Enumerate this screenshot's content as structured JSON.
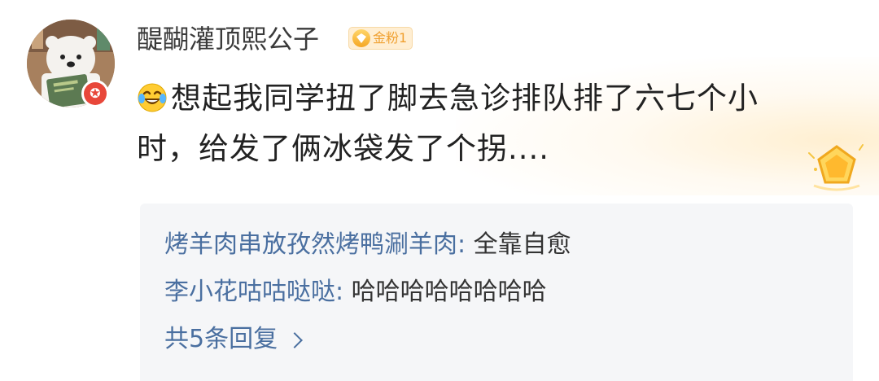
{
  "user": {
    "name": "醍醐灌顶熙公子",
    "fan_badge": "金粉1",
    "avatar_badge_icon": "✪"
  },
  "comment": {
    "emoji": "laugh-cry-emoji",
    "text": "想起我同学扭了脚去急诊排队排了六七个小时，给发了俩冰袋发了个拐...."
  },
  "replies": {
    "items": [
      {
        "name": "烤羊肉串放孜然烤鸭涮羊肉",
        "sep": ": ",
        "text": "全靠自愈"
      },
      {
        "name": "李小花咕咕哒哒",
        "sep": ": ",
        "text": "哈哈哈哈哈哈哈哈"
      }
    ],
    "more_label": "共5条回复"
  },
  "colors": {
    "link_blue": "#4a6fa0",
    "badge_gold": "#f0a030",
    "reply_bg": "#f5f6f8"
  }
}
